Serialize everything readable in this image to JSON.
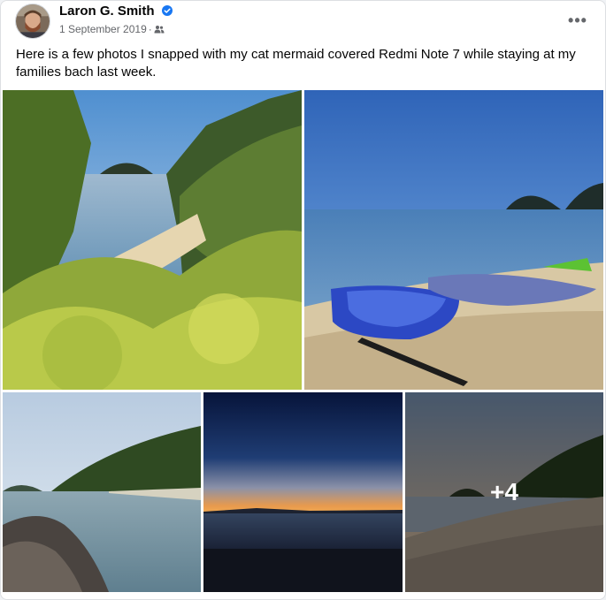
{
  "post": {
    "author": "Laron G. Smith",
    "verified": true,
    "date": "1 September 2019",
    "separator": "·",
    "audience_icon": "friends-icon",
    "more_icon": "ellipsis-icon",
    "more_label": "•••",
    "caption": "Here is a few photos I snapped with my cat mermaid covered Redmi Note 7 while staying at my families bach last week."
  },
  "photos": {
    "more_count": "+4"
  },
  "colors": {
    "verified_blue": "#1877f2",
    "secondary_text": "#65676b"
  }
}
